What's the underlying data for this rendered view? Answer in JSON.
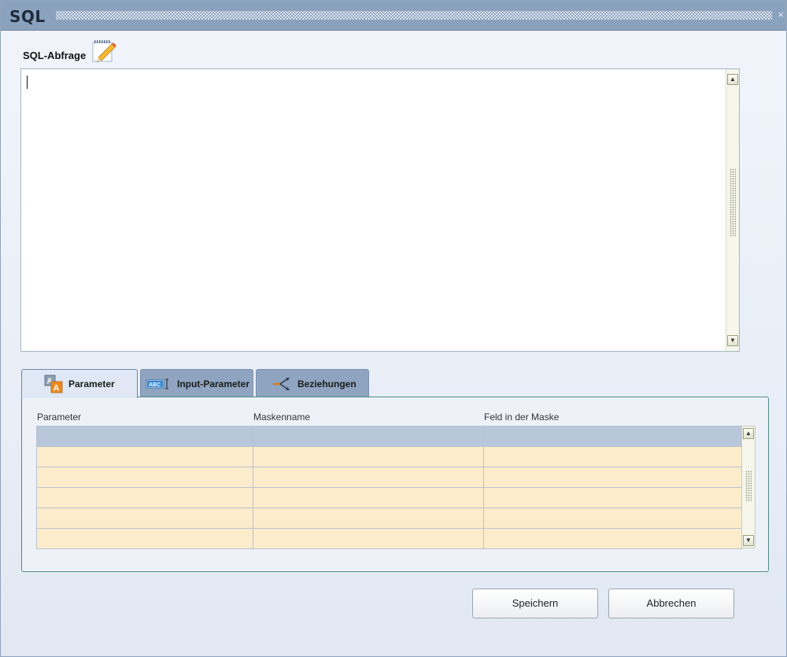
{
  "window": {
    "title": "SQL",
    "close_symbol": "×"
  },
  "query": {
    "label": "SQL-Abfrage",
    "value": ""
  },
  "tabs": [
    {
      "label": "Parameter",
      "icon": "text-parameter-icon",
      "active": true
    },
    {
      "label": "Input-Parameter",
      "icon": "text-field-icon",
      "active": false
    },
    {
      "label": "Beziehungen",
      "icon": "relation-arrows-icon",
      "active": false
    }
  ],
  "grid": {
    "columns": [
      "Parameter",
      "Maskenname",
      "Feld in der Maske"
    ],
    "rows": [
      [
        "",
        "",
        ""
      ],
      [
        "",
        "",
        ""
      ],
      [
        "",
        "",
        ""
      ],
      [
        "",
        "",
        ""
      ],
      [
        "",
        "",
        ""
      ],
      [
        "",
        "",
        ""
      ]
    ]
  },
  "buttons": {
    "save": "Speichern",
    "cancel": "Abbrechen"
  },
  "colors": {
    "title_bar": "#8ba2bf",
    "row_fill": "#fdeccb",
    "selected_row": "#b9c7da",
    "panel_border": "#4f8a86"
  }
}
